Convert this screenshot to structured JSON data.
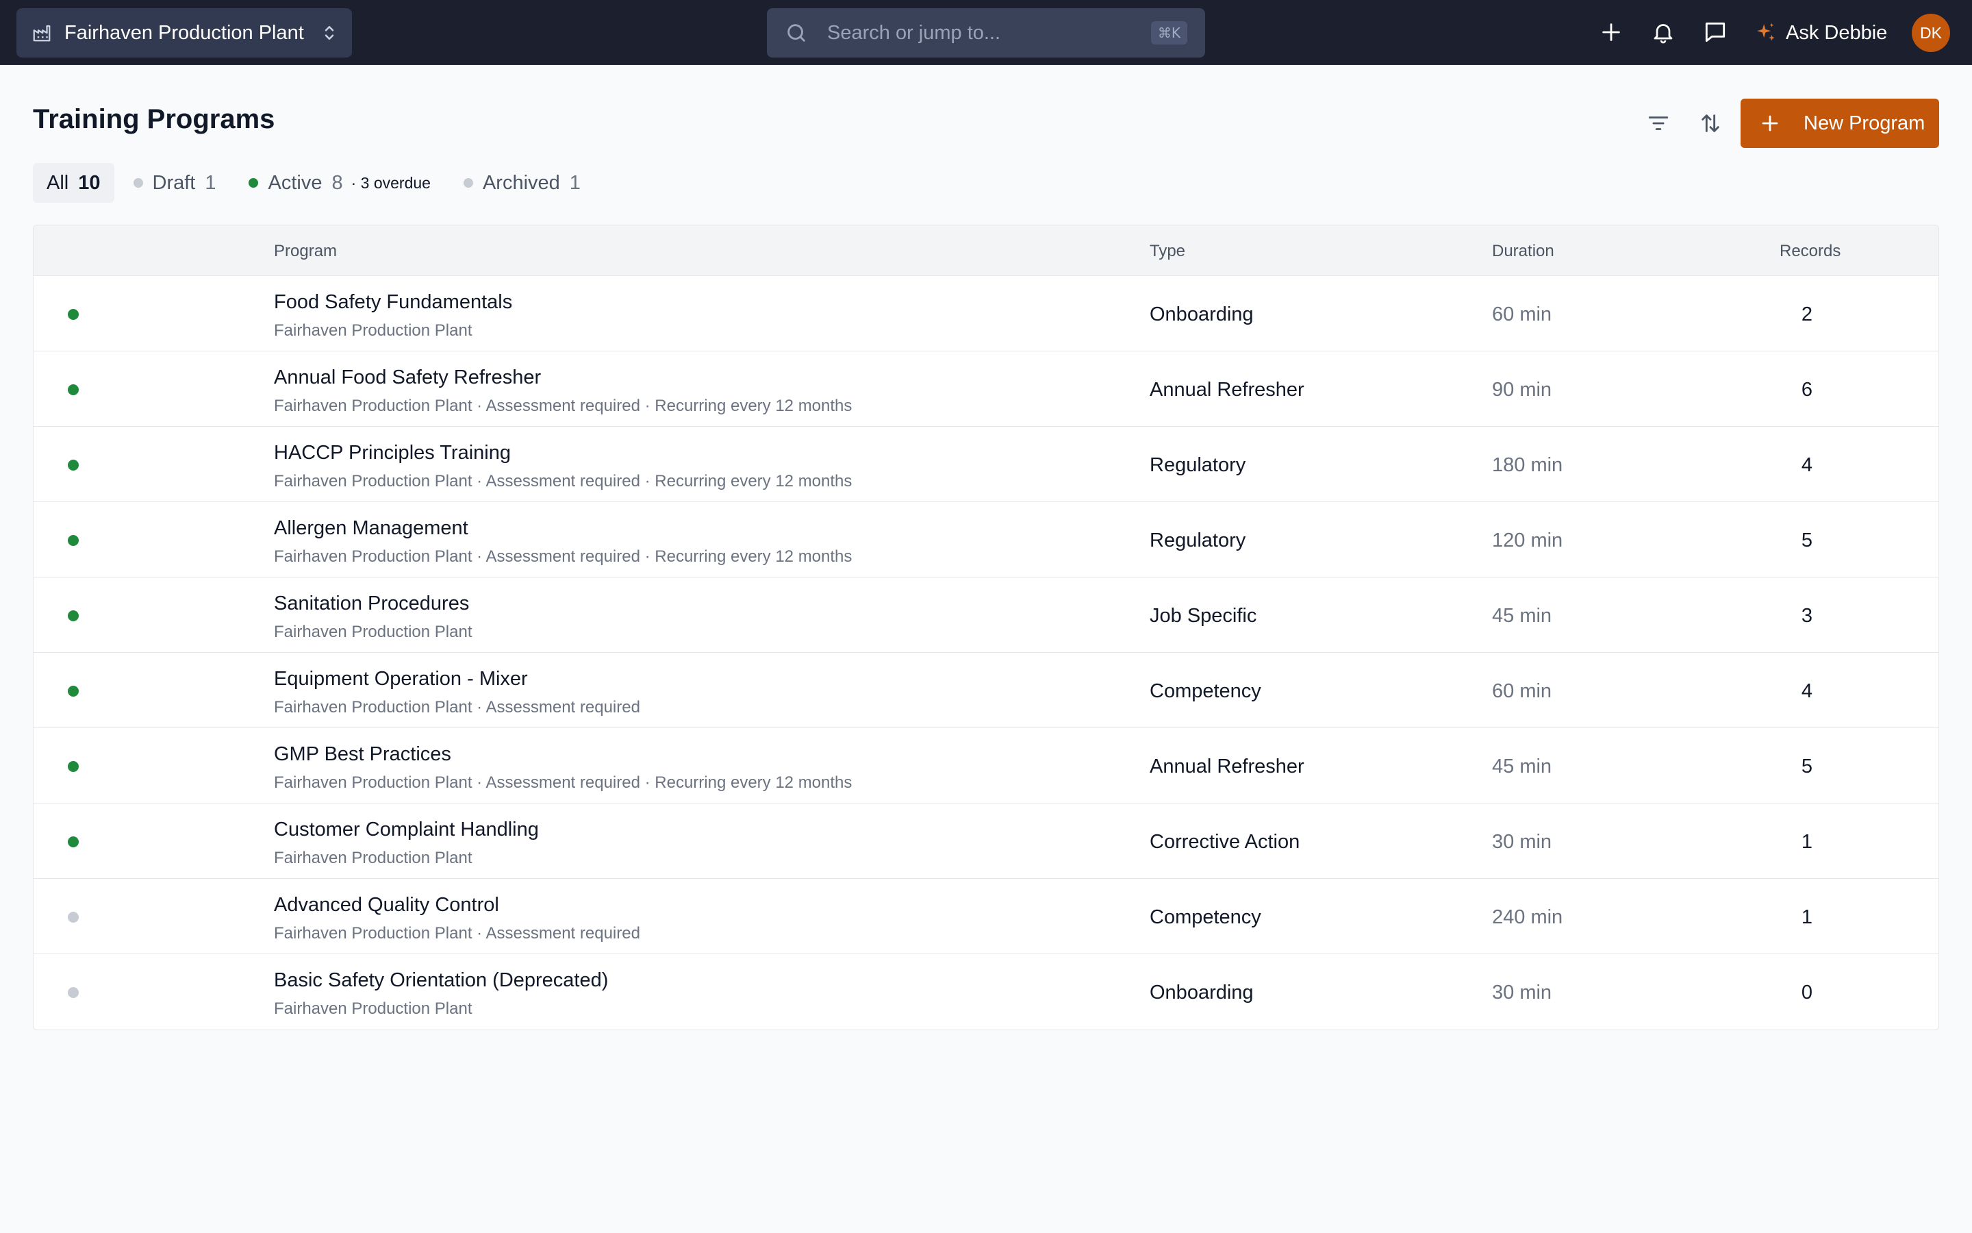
{
  "topbar": {
    "site": "Fairhaven Production Plant",
    "search_placeholder": "Search or jump to...",
    "search_shortcut": "⌘K",
    "ask_label": "Ask Debbie",
    "avatar_initials": "DK"
  },
  "header": {
    "title": "Training Programs",
    "new_button": "New Program"
  },
  "tabs": [
    {
      "label": "All",
      "count": "10",
      "dot": null,
      "extra": ""
    },
    {
      "label": "Draft",
      "count": "1",
      "dot": "#c7cbd3",
      "extra": ""
    },
    {
      "label": "Active",
      "count": "8",
      "dot": "#1f8a3b",
      "extra": "· 3 overdue"
    },
    {
      "label": "Archived",
      "count": "1",
      "dot": "#c7cbd3",
      "extra": ""
    }
  ],
  "table": {
    "columns": {
      "program": "Program",
      "type": "Type",
      "duration": "Duration",
      "records": "Records"
    },
    "rows": [
      {
        "status": "active",
        "name": "Food Safety Fundamentals",
        "meta": "Fairhaven Production Plant",
        "type": "Onboarding",
        "duration": "60 min",
        "records": "2"
      },
      {
        "status": "active",
        "name": "Annual Food Safety Refresher",
        "meta": "Fairhaven Production Plant · Assessment required · Recurring every 12 months",
        "type": "Annual Refresher",
        "duration": "90 min",
        "records": "6"
      },
      {
        "status": "active",
        "name": "HACCP Principles Training",
        "meta": "Fairhaven Production Plant · Assessment required · Recurring every 12 months",
        "type": "Regulatory",
        "duration": "180 min",
        "records": "4"
      },
      {
        "status": "active",
        "name": "Allergen Management",
        "meta": "Fairhaven Production Plant · Assessment required · Recurring every 12 months",
        "type": "Regulatory",
        "duration": "120 min",
        "records": "5"
      },
      {
        "status": "active",
        "name": "Sanitation Procedures",
        "meta": "Fairhaven Production Plant",
        "type": "Job Specific",
        "duration": "45 min",
        "records": "3"
      },
      {
        "status": "active",
        "name": "Equipment Operation - Mixer",
        "meta": "Fairhaven Production Plant · Assessment required",
        "type": "Competency",
        "duration": "60 min",
        "records": "4"
      },
      {
        "status": "active",
        "name": "GMP Best Practices",
        "meta": "Fairhaven Production Plant · Assessment required · Recurring every 12 months",
        "type": "Annual Refresher",
        "duration": "45 min",
        "records": "5"
      },
      {
        "status": "active",
        "name": "Customer Complaint Handling",
        "meta": "Fairhaven Production Plant",
        "type": "Corrective Action",
        "duration": "30 min",
        "records": "1"
      },
      {
        "status": "inactive",
        "name": "Advanced Quality Control",
        "meta": "Fairhaven Production Plant · Assessment required",
        "type": "Competency",
        "duration": "240 min",
        "records": "1"
      },
      {
        "status": "inactive",
        "name": "Basic Safety Orientation (Deprecated)",
        "meta": "Fairhaven Production Plant",
        "type": "Onboarding",
        "duration": "30 min",
        "records": "0"
      }
    ]
  },
  "colors": {
    "topbar": "#1c1f2e",
    "accent": "#c2570c",
    "status_active": "#1f8a3b",
    "status_inactive": "#c7cbd3"
  }
}
